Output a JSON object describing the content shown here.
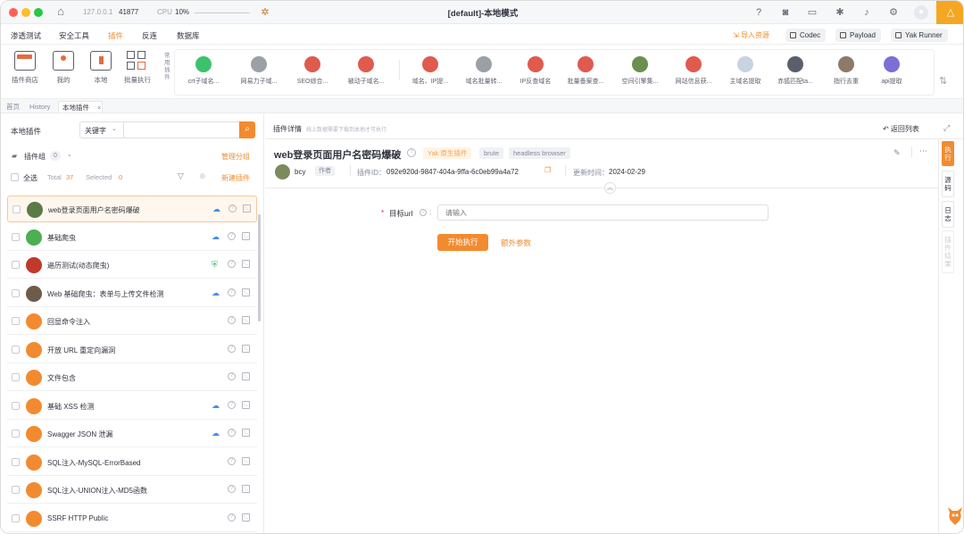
{
  "titlebar": {
    "address": "127.0.0.1",
    "port": "41877",
    "cpu_label": "CPU",
    "cpu_value": "10%",
    "title": "[default]-本地模式"
  },
  "menu": {
    "items": [
      "渗透测试",
      "安全工具",
      "插件",
      "反连",
      "数据库"
    ],
    "active": "插件",
    "import_label": "导入资源",
    "codec_label": "Codec",
    "payload_label": "Payload",
    "yakrunner_label": "Yak Runner"
  },
  "toolbar": {
    "tools": [
      "插件商店",
      "我的",
      "本地",
      "批量执行"
    ],
    "common_label": "常用插件",
    "plugins": [
      "crt子域名...",
      "网易力子域...",
      "SEO综合...",
      "被动子域名...",
      "域名、IP提...",
      "域名批量转...",
      "IP反查域名",
      "批量备案查...",
      "空间引擎集...",
      "网站信息获...",
      "主域名提取",
      "赤狐匹配ta...",
      "指行去重",
      "api提取"
    ]
  },
  "tabs": {
    "items": [
      "首页",
      "History",
      "本地插件"
    ],
    "close": "×"
  },
  "left": {
    "title": "本地插件",
    "search_select": "关键字",
    "group_label": "插件组",
    "group_count": "0",
    "manage_group": "管理分组",
    "select_all": "全选",
    "total_label": "Total",
    "total": "37",
    "selected_label": "Selected",
    "selected": "0",
    "new_plugin": "新建插件",
    "plugins": [
      {
        "name": "web登录页面用户名密码爆破",
        "cloud": true,
        "shield": false
      },
      {
        "name": "基础爬虫",
        "cloud": true,
        "shield": false
      },
      {
        "name": "遍历测试(动态爬虫)",
        "cloud": false,
        "shield": true
      },
      {
        "name": "Web 基础爬虫：表单与上传文件检测",
        "cloud": true,
        "shield": false
      },
      {
        "name": "回显命令注入",
        "cloud": false,
        "shield": false
      },
      {
        "name": "开放 URL 重定向漏洞",
        "cloud": false,
        "shield": false
      },
      {
        "name": "文件包含",
        "cloud": false,
        "shield": false
      },
      {
        "name": "基础 XSS 检测",
        "cloud": true,
        "shield": false
      },
      {
        "name": "Swagger JSON 泄漏",
        "cloud": true,
        "shield": false
      },
      {
        "name": "SQL注入-MySQL-ErrorBased",
        "cloud": false,
        "shield": false
      },
      {
        "name": "SQL注入-UNION注入-MD5函数",
        "cloud": false,
        "shield": false
      },
      {
        "name": "SSRF HTTP Public",
        "cloud": false,
        "shield": false
      }
    ]
  },
  "right": {
    "header": "插件详情",
    "header_hint": "线上数据需要下载到本地才可执行",
    "back": "返回列表",
    "plugin_title": "web登录页面用户名密码爆破",
    "tags": [
      "Yak 原生插件",
      "brute",
      "headless browser"
    ],
    "author": "bcy",
    "author_badge": "作者",
    "id_label": "插件ID：",
    "plugin_id": "092e920d-9847-404a-9ffa-6c0eb99a4a72",
    "update_label": "更新时间：",
    "update_time": "2024-02-29",
    "field_label": "目标url",
    "field_placeholder": "请输入",
    "run_button": "开始执行",
    "extra_params": "额外参数",
    "side_tabs": [
      "执行",
      "源码",
      "日志",
      "插件结果"
    ]
  }
}
